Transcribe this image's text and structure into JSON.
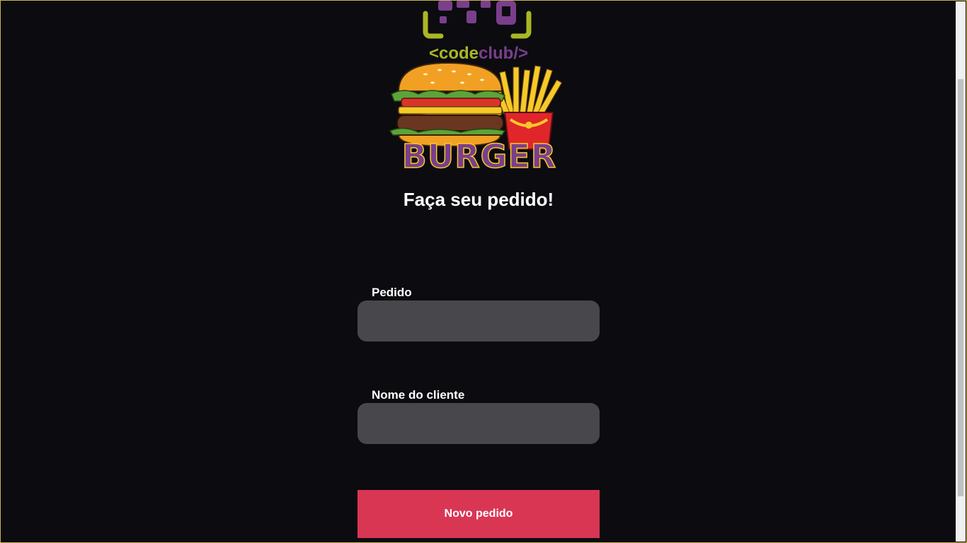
{
  "logo": {
    "brand_prefix": "<",
    "brand_code": "code",
    "brand_club": "club",
    "brand_suffix": "/>",
    "burger_text": "BURGER",
    "colors": {
      "purple": "#7a3f8c",
      "lime": "#a9b724",
      "bun": "#f2a024",
      "cheese": "#f7c928",
      "patty": "#6b3620",
      "lettuce": "#5da33a",
      "tomato": "#d9342a",
      "fries_box": "#e0262a"
    }
  },
  "page": {
    "title": "Faça seu pedido!"
  },
  "form": {
    "order_label": "Pedido",
    "order_value": "",
    "customer_label": "Nome do cliente",
    "customer_value": "",
    "submit_label": "Novo pedido"
  },
  "theme": {
    "background": "#0c0b10",
    "input_bg": "#48474c",
    "button_bg": "#d93654"
  }
}
